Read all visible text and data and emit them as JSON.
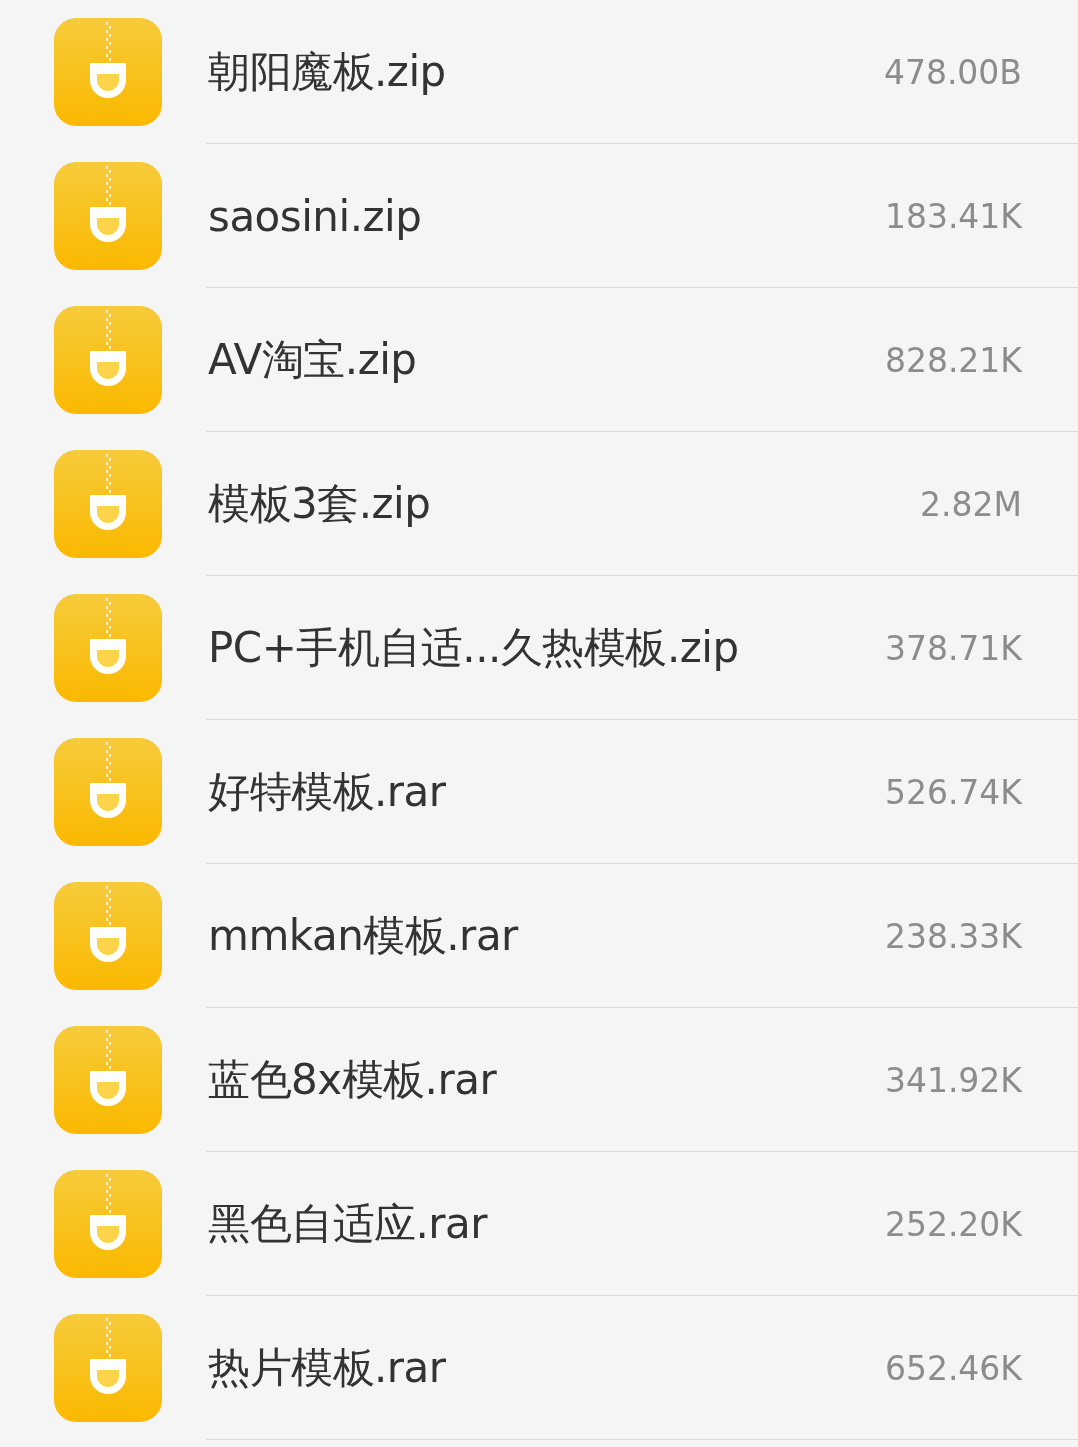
{
  "files": [
    {
      "name": "朝阳魔板.zip",
      "size": "478.00B"
    },
    {
      "name": "saosini.zip",
      "size": "183.41K"
    },
    {
      "name": "AV淘宝.zip",
      "size": "828.21K"
    },
    {
      "name": "模板3套.zip",
      "size": "2.82M"
    },
    {
      "name": "PC+手机自适...久热模板.zip",
      "size": "378.71K"
    },
    {
      "name": "好特模板.rar",
      "size": "526.74K"
    },
    {
      "name": "mmkan模板.rar",
      "size": "238.33K"
    },
    {
      "name": "蓝色8x模板.rar",
      "size": "341.92K"
    },
    {
      "name": "黑色自适应.rar",
      "size": "252.20K"
    },
    {
      "name": "热片模板.rar",
      "size": "652.46K"
    }
  ]
}
